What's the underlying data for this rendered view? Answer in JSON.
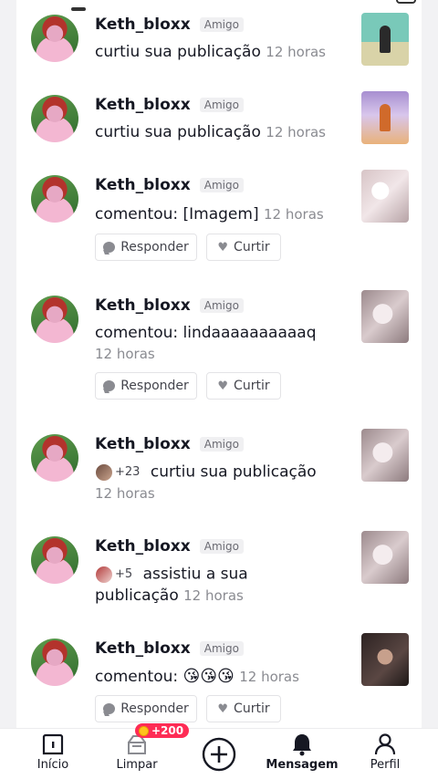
{
  "notifications": [
    {
      "name": "Keth_bloxx",
      "badge": "Amigo",
      "text": "curtiu sua publicação",
      "time": "12 horas",
      "thumb": "t1"
    },
    {
      "name": "Keth_bloxx",
      "badge": "Amigo",
      "text": "curtiu sua publicação",
      "time": "12 horas",
      "thumb": "t2"
    },
    {
      "name": "Keth_bloxx",
      "badge": "Amigo",
      "text": "comentou: [Imagem]",
      "time": "12 horas",
      "thumb": "t3",
      "reply_label": "Responder",
      "like_label": "Curtir"
    },
    {
      "name": "Keth_bloxx",
      "badge": "Amigo",
      "text": "comentou: lindaaaaaaaaaaq",
      "time": "12 horas",
      "thumb": "t4",
      "reply_label": "Responder",
      "like_label": "Curtir"
    },
    {
      "name": "Keth_bloxx",
      "badge": "Amigo",
      "others": "+23",
      "text": "curtiu sua publicação",
      "time": "12 horas",
      "thumb": "t4"
    },
    {
      "name": "Keth_bloxx",
      "badge": "Amigo",
      "others": "+5",
      "text": "assistiu a sua publicação",
      "time": "12 horas",
      "thumb": "t4"
    },
    {
      "name": "Keth_bloxx",
      "badge": "Amigo",
      "text": "comentou:",
      "emojis": "😘😘😘",
      "time": "12 horas",
      "thumb": "t5",
      "reply_label": "Responder",
      "like_label": "Curtir"
    }
  ],
  "nav": {
    "home": "Início",
    "clean": "Limpar",
    "clean_badge": "+200",
    "create": "create",
    "messages": "Mensagem",
    "profile": "Perfil"
  },
  "icons": {
    "home": "home-icon",
    "clean": "broom-icon",
    "create": "plus-icon",
    "messages": "bell-icon",
    "profile": "person-icon"
  },
  "colors": {
    "accent": "#fe2c55",
    "text": "#161823",
    "muted": "#8a8b91"
  }
}
